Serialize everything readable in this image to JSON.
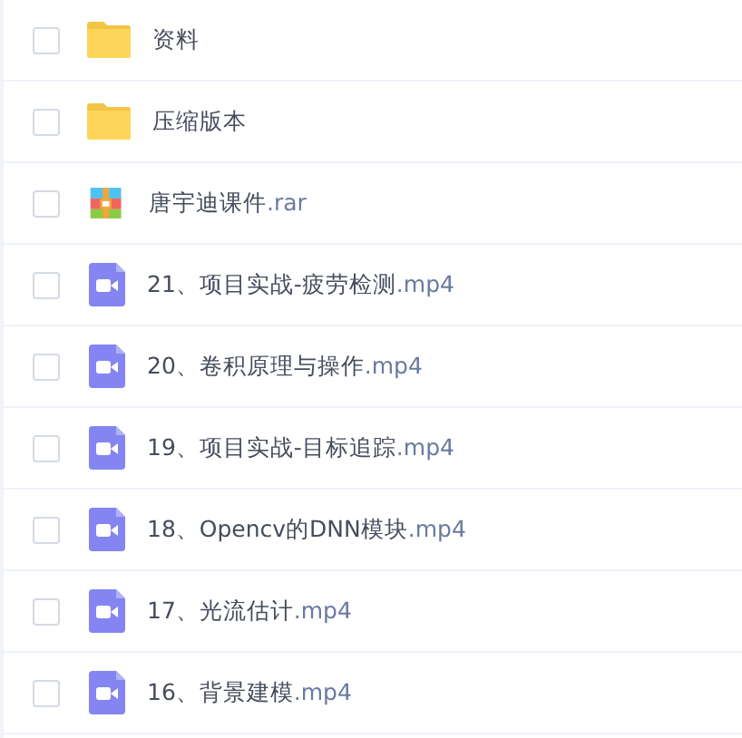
{
  "files": [
    {
      "kind": "folder",
      "name": "资料",
      "checked": false
    },
    {
      "kind": "folder",
      "name": "压缩版本",
      "checked": false
    },
    {
      "kind": "archive",
      "name": "唐宇迪课件",
      "extension": ".rar",
      "checked": false
    },
    {
      "kind": "video",
      "name": "21、项目实战-疲劳检测",
      "extension": ".mp4",
      "checked": false
    },
    {
      "kind": "video",
      "name": "20、卷积原理与操作",
      "extension": ".mp4",
      "checked": false
    },
    {
      "kind": "video",
      "name": "19、项目实战-目标追踪",
      "extension": ".mp4",
      "checked": false
    },
    {
      "kind": "video",
      "name": "18、Opencv的DNN模块",
      "extension": ".mp4",
      "checked": false
    },
    {
      "kind": "video",
      "name": "17、光流估计",
      "extension": ".mp4",
      "checked": false
    },
    {
      "kind": "video",
      "name": "16、背景建模",
      "extension": ".mp4",
      "checked": false
    }
  ]
}
